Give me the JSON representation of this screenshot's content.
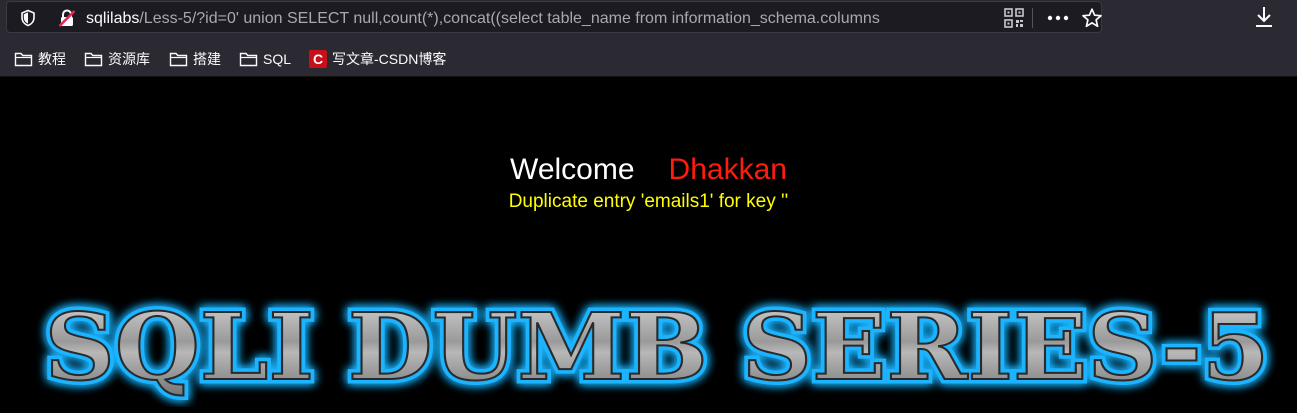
{
  "browser": {
    "url_host": "sqlilabs",
    "url_rest": "/Less-5/?id=0' union SELECT null,count(*),concat((select table_name from information_schema.columns",
    "icons": [
      "shield-icon",
      "insecure-lock-icon",
      "qr-code-icon",
      "more-icon",
      "star-icon",
      "download-icon"
    ]
  },
  "bookmarks": [
    {
      "label": "教程",
      "icon": "folder-icon"
    },
    {
      "label": "资源库",
      "icon": "folder-icon"
    },
    {
      "label": "搭建",
      "icon": "folder-icon"
    },
    {
      "label": "SQL",
      "icon": "folder-icon"
    },
    {
      "label": "写文章-CSDN博客",
      "icon": "csdn-icon",
      "icon_letter": "C"
    }
  ],
  "page": {
    "welcome": "Welcome",
    "name": "Dhakkan",
    "message": "Duplicate entry 'emails1' for key ''",
    "banner_text": "SQLI DUMB SERIES-5"
  },
  "colors": {
    "chrome": "#2b2a33",
    "urlbar": "#1c1b22",
    "page_background": "#000000",
    "welcome": "#ffffff",
    "name": "#ff1c0c",
    "message": "#ffff00",
    "banner_glow": "#1fb3ff",
    "banner_metal": "#a8a8a8"
  }
}
